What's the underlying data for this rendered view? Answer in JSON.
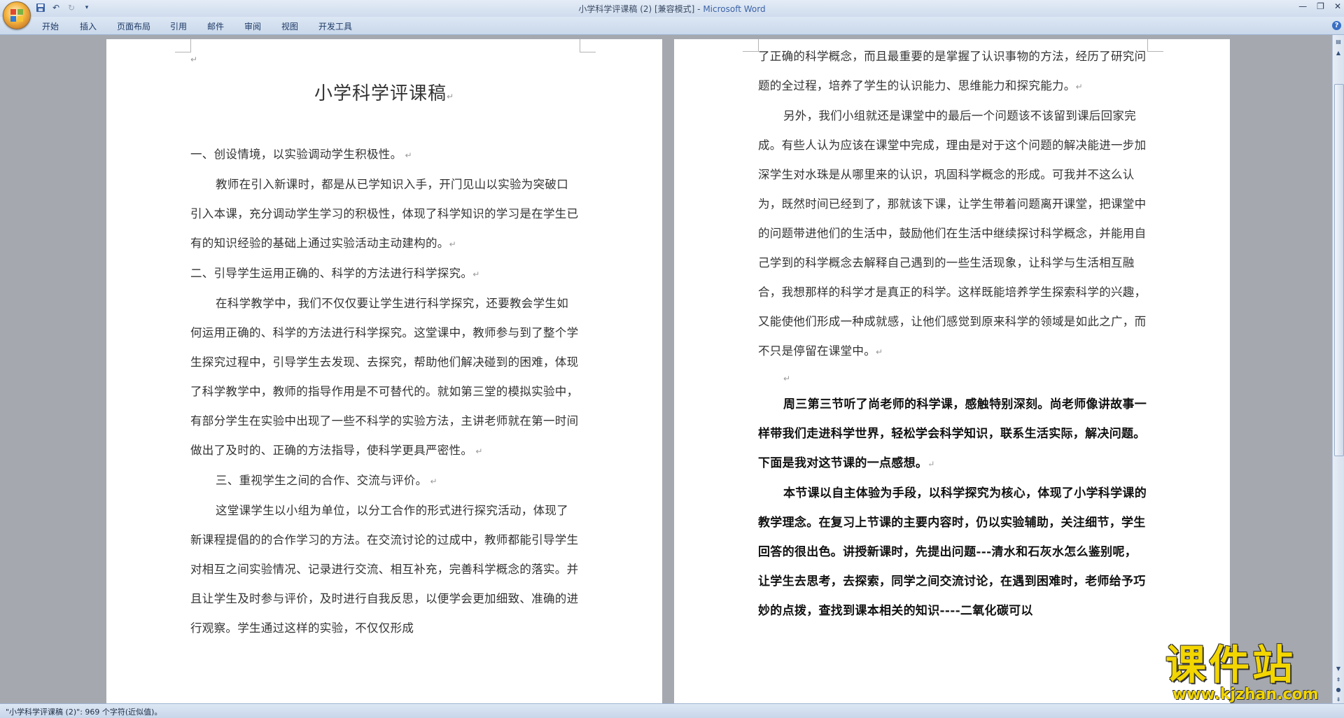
{
  "window": {
    "title_doc": "小学科学评课稿 (2) [兼容模式] - ",
    "title_app": "Microsoft Word"
  },
  "menu": {
    "tabs": [
      "开始",
      "插入",
      "页面布局",
      "引用",
      "邮件",
      "审阅",
      "视图",
      "开发工具"
    ]
  },
  "page_left": {
    "title": "小学科学评课稿",
    "paragraphs": [
      {
        "kind": "heading",
        "text": "一、创设情境，以实验调动学生积极性。"
      },
      {
        "kind": "indent",
        "text": "教师在引入新课时，都是从已学知识入手，开门见山以实验为突破口引入本课，充分调动学生学习的积极性，体现了科学知识的学习是在学生已有的知识经验的基础上通过实验活动主动建构的。"
      },
      {
        "kind": "heading",
        "text": "二、引导学生运用正确的、科学的方法进行科学探究。"
      },
      {
        "kind": "indent",
        "text": "在科学教学中，我们不仅仅要让学生进行科学探究，还要教会学生如何运用正确的、科学的方法进行科学探究。这堂课中，教师参与到了整个学生探究过程中，引导学生去发现、去探究，帮助他们解决碰到的困难，体现了科学教学中，教师的指导作用是不可替代的。就如第三堂的模拟实验中，有部分学生在实验中出现了一些不科学的实验方法，主讲老师就在第一时间做出了及时的、正确的方法指导，使科学更具严密性。"
      },
      {
        "kind": "indent",
        "text": "三、重视学生之间的合作、交流与评价。"
      },
      {
        "kind": "indent",
        "text": "这堂课学生以小组为单位，以分工合作的形式进行探究活动，体现了新课程提倡的的合作学习的方法。在交流讨论的过成中，教师都能引导学生对相互之间实验情况、记录进行交流、相互补充，完善科学概念的落实。并且让学生及时参与评价，及时进行自我反思，以便学会更加细致、准确的进行观察。学生通过这样的实验，不仅仅形成"
      }
    ]
  },
  "page_right": {
    "paragraphs": [
      {
        "kind": "plain",
        "text": "了正确的科学概念，而且最重要的是掌握了认识事物的方法，经历了研究问题的全过程，培养了学生的认识能力、思维能力和探究能力。"
      },
      {
        "kind": "indent",
        "text": "另外，我们小组就还是课堂中的最后一个问题该不该留到课后回家完成。有些人认为应该在课堂中完成，理由是对于这个问题的解决能进一步加深学生对水珠是从哪里来的认识，巩固科学概念的形成。可我并不这么认为，既然时间已经到了，那就该下课，让学生带着问题离开课堂，把课堂中的问题带进他们的生活中，鼓励他们在生活中继续探讨科学概念，并能用自己学到的科学概念去解释自己遇到的一些生活现象，让科学与生活相互融合，我想那样的科学才是真正的科学。这样既能培养学生探索科学的兴趣，又能使他们形成一种成就感，让他们感觉到原来科学的领域是如此之广，而不只是停留在课堂中。"
      },
      {
        "kind": "empty",
        "text": ""
      },
      {
        "kind": "bold",
        "text": "周三第三节听了尚老师的科学课，感触特别深刻。尚老师像讲故事一样带我们走进科学世界，轻松学会科学知识，联系生活实际，解决问题。下面是我对这节课的一点感想。"
      },
      {
        "kind": "bold",
        "text": "本节课以自主体验为手段，以科学探究为核心，体现了小学科学课的教学理念。在复习上节课的主要内容时，仍以实验辅助，关注细节，学生回答的很出色。讲授新课时，先提出问题---清水和石灰水怎么鉴别呢，让学生去思考，去探索，同学之间交流讨论，在遇到困难时，老师给予巧妙的点拨，查找到课本相关的知识----二氧化碳可以"
      }
    ]
  },
  "status": {
    "text": "\"小学科学评课稿 (2)\": 969 个字符(近似值)。"
  },
  "watermark": {
    "brand": "课件站",
    "url": "www.kjzhan.com"
  },
  "colors": {
    "background": "#a5a9af",
    "ribbon": "#dde7f4",
    "watermark": "#f3d600"
  }
}
